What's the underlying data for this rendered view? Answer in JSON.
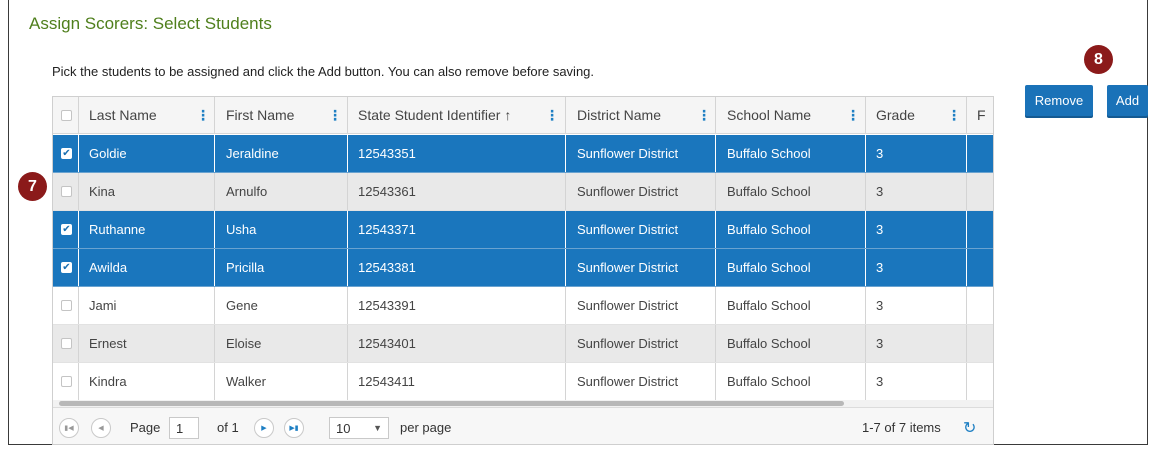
{
  "page": {
    "title": "Assign Scorers: Select Students",
    "instructions": "Pick the students to be assigned and click the Add button. You can also remove before saving."
  },
  "buttons": {
    "remove": "Remove",
    "add": "Add"
  },
  "badges": {
    "seven": "7",
    "eight": "8"
  },
  "grid": {
    "columns": [
      "Last Name",
      "First Name",
      "State Student Identifier ↑",
      "District Name",
      "School Name",
      "Grade",
      "F"
    ],
    "rows": [
      {
        "selected": true,
        "cells": [
          "Goldie",
          "Jeraldine",
          "12543351",
          "Sunflower District",
          "Buffalo School",
          "3"
        ]
      },
      {
        "selected": false,
        "cells": [
          "Kina",
          "Arnulfo",
          "12543361",
          "Sunflower District",
          "Buffalo School",
          "3"
        ]
      },
      {
        "selected": true,
        "cells": [
          "Ruthanne",
          "Usha",
          "12543371",
          "Sunflower District",
          "Buffalo School",
          "3"
        ]
      },
      {
        "selected": true,
        "cells": [
          "Awilda",
          "Pricilla",
          "12543381",
          "Sunflower District",
          "Buffalo School",
          "3"
        ]
      },
      {
        "selected": false,
        "cells": [
          "Jami",
          "Gene",
          "12543391",
          "Sunflower District",
          "Buffalo School",
          "3"
        ]
      },
      {
        "selected": false,
        "cells": [
          "Ernest",
          "Eloise",
          "12543401",
          "Sunflower District",
          "Buffalo School",
          "3"
        ]
      },
      {
        "selected": false,
        "cells": [
          "Kindra",
          "Walker",
          "12543411",
          "Sunflower District",
          "Buffalo School",
          "3"
        ]
      }
    ],
    "checkmark": "✔"
  },
  "pager": {
    "page_label": "Page",
    "page_value": "1",
    "of_label": "of 1",
    "per_page_value": "10",
    "per_page_label": "per page",
    "items_label": "1-7 of 7 items",
    "icons": {
      "first": "first-page-icon",
      "prev": "prev-page-icon",
      "next": "next-page-icon",
      "last": "last-page-icon",
      "refresh": "refresh-icon"
    }
  },
  "colors": {
    "selected_row": "#1a76bd",
    "title": "#4f7f1c",
    "badge": "#8b1a1a",
    "button": "#1a72b8"
  }
}
